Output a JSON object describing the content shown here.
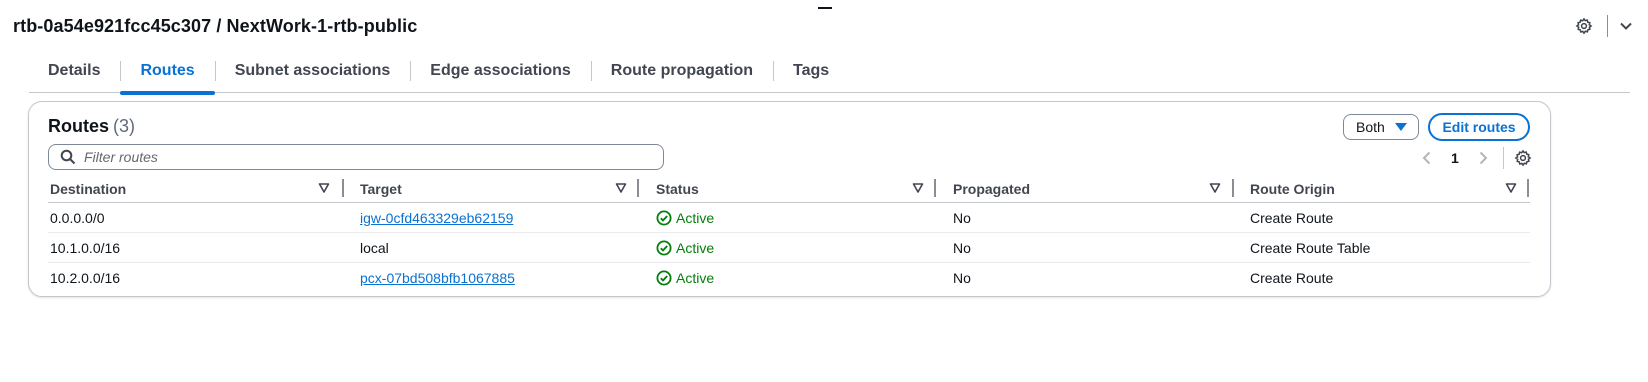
{
  "header": {
    "title": "rtb-0a54e921fcc45c307 / NextWork-1-rtb-public",
    "settings_icon": "gear-icon",
    "collapse_icon": "chevron-down-icon"
  },
  "tabs": [
    {
      "label": "Details",
      "active": false
    },
    {
      "label": "Routes",
      "active": true
    },
    {
      "label": "Subnet associations",
      "active": false
    },
    {
      "label": "Edge associations",
      "active": false
    },
    {
      "label": "Route propagation",
      "active": false
    },
    {
      "label": "Tags",
      "active": false
    }
  ],
  "routes_panel": {
    "title": "Routes",
    "count": "(3)",
    "filter_select": {
      "selected": "Both"
    },
    "edit_button": "Edit routes",
    "search": {
      "placeholder": "Filter routes",
      "value": ""
    },
    "pagination": {
      "current_page": "1"
    },
    "columns": [
      "Destination",
      "Target",
      "Status",
      "Propagated",
      "Route Origin"
    ],
    "rows": [
      {
        "destination": "0.0.0.0/0",
        "target": "igw-0cfd463329eb62159",
        "target_link": true,
        "status": "Active",
        "propagated": "No",
        "origin": "Create Route"
      },
      {
        "destination": "10.1.0.0/16",
        "target": "local",
        "target_link": false,
        "status": "Active",
        "propagated": "No",
        "origin": "Create Route Table"
      },
      {
        "destination": "10.2.0.0/16",
        "target": "pcx-07bd508bfb1067885",
        "target_link": true,
        "status": "Active",
        "propagated": "No",
        "origin": "Create Route"
      }
    ]
  },
  "colors": {
    "accent": "#0972d3",
    "success": "#037f0c",
    "text": "#0f141a"
  }
}
